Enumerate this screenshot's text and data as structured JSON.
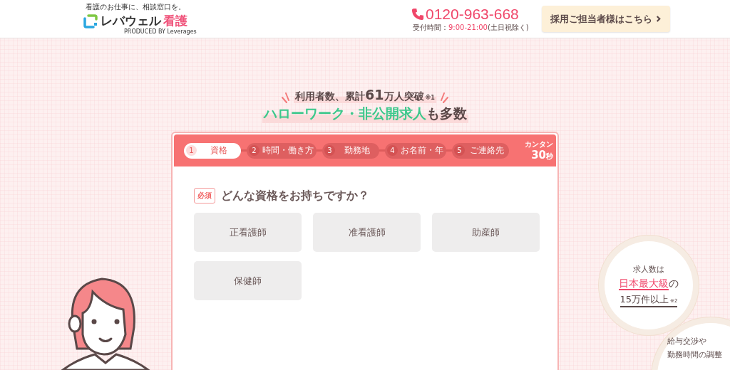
{
  "header": {
    "tagline": "看護のお仕事に、相談窓口を。",
    "logo": {
      "brand": "レバウェル",
      "brand_accent": "看護",
      "produced_by": "PRODUCED BY Leverages"
    },
    "phone": "0120-963-668",
    "hours_label": "受付時間：",
    "hours": "9:00-21:00",
    "hours_note": "(土日祝除く)",
    "employer_button": "採用ご担当者様はこちら"
  },
  "hero": {
    "line1": "利用者数、累計**61**万人突破",
    "line1_note": "※1",
    "line2_highlight": "ハローワーク・非公開求人",
    "line2_rest": "も多数"
  },
  "form": {
    "steps": [
      {
        "number": "1",
        "label": "資格",
        "selected": true
      },
      {
        "number": "2",
        "label": "時間・働き方",
        "selected": false
      },
      {
        "number": "3",
        "label": "勤務地",
        "selected": false
      },
      {
        "number": "4",
        "label": "お名前・年",
        "selected": false
      },
      {
        "number": "5",
        "label": "ご連絡先",
        "selected": false
      }
    ],
    "duration_label": "カンタン",
    "duration_number": "30",
    "duration_unit": "秒",
    "required_badge": "必須",
    "question": "どんな資格をお持ちですか？",
    "options": [
      {
        "label": "正看護師",
        "selected": false
      },
      {
        "label": "准看護師",
        "selected": false
      },
      {
        "label": "助産師",
        "selected": false
      },
      {
        "label": "保健師",
        "selected": false
      }
    ]
  },
  "features": [
    {
      "line1": "求人数は",
      "highlight": "日本最大級",
      "highlight_rest": "の",
      "line3": "15万件以上",
      "note": "※2"
    },
    {
      "line1": "給与交渉や",
      "line2": "勤務時間の調整"
    }
  ]
}
